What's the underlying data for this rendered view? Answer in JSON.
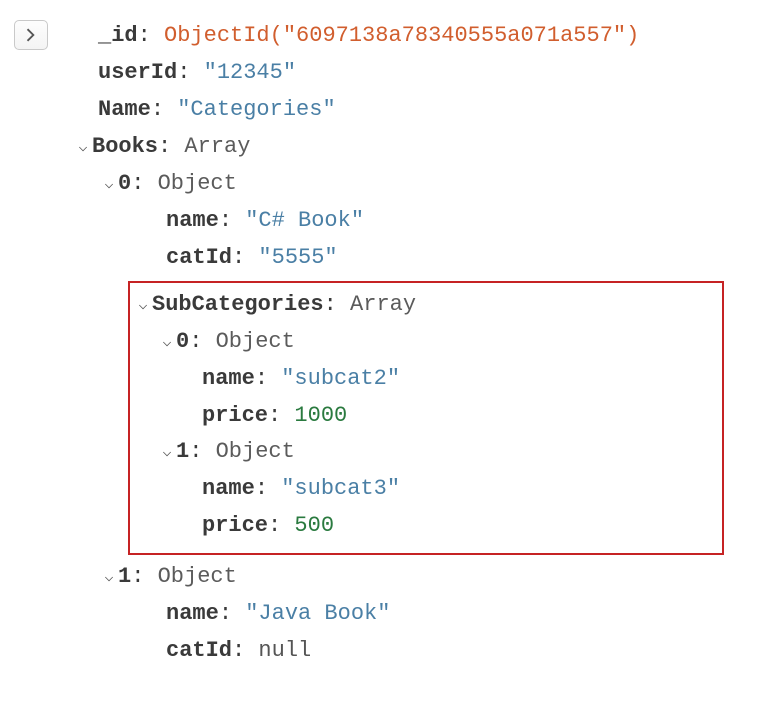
{
  "doc": {
    "id_key": "_id",
    "id_func": "ObjectId",
    "id_val": "\"6097138a78340555a071a557\"",
    "userId_key": "userId",
    "userId_val": "\"12345\"",
    "name_key": "Name",
    "name_val": "\"Categories\"",
    "books_key": "Books",
    "books_type": "Array",
    "book0_idx": "0",
    "book0_type": "Object",
    "book0_name_key": "name",
    "book0_name_val": "\"C# Book\"",
    "book0_cat_key": "catId",
    "book0_cat_val": "\"5555\"",
    "subcats_key": "SubCategories",
    "subcats_type": "Array",
    "sc0_idx": "0",
    "sc0_type": "Object",
    "sc0_name_key": "name",
    "sc0_name_val": "\"subcat2\"",
    "sc0_price_key": "price",
    "sc0_price_val": "1000",
    "sc1_idx": "1",
    "sc1_type": "Object",
    "sc1_name_key": "name",
    "sc1_name_val": "\"subcat3\"",
    "sc1_price_key": "price",
    "sc1_price_val": "500",
    "book1_idx": "1",
    "book1_type": "Object",
    "book1_name_key": "name",
    "book1_name_val": "\"Java Book\"",
    "book1_cat_key": "catId",
    "book1_cat_val": "null"
  }
}
